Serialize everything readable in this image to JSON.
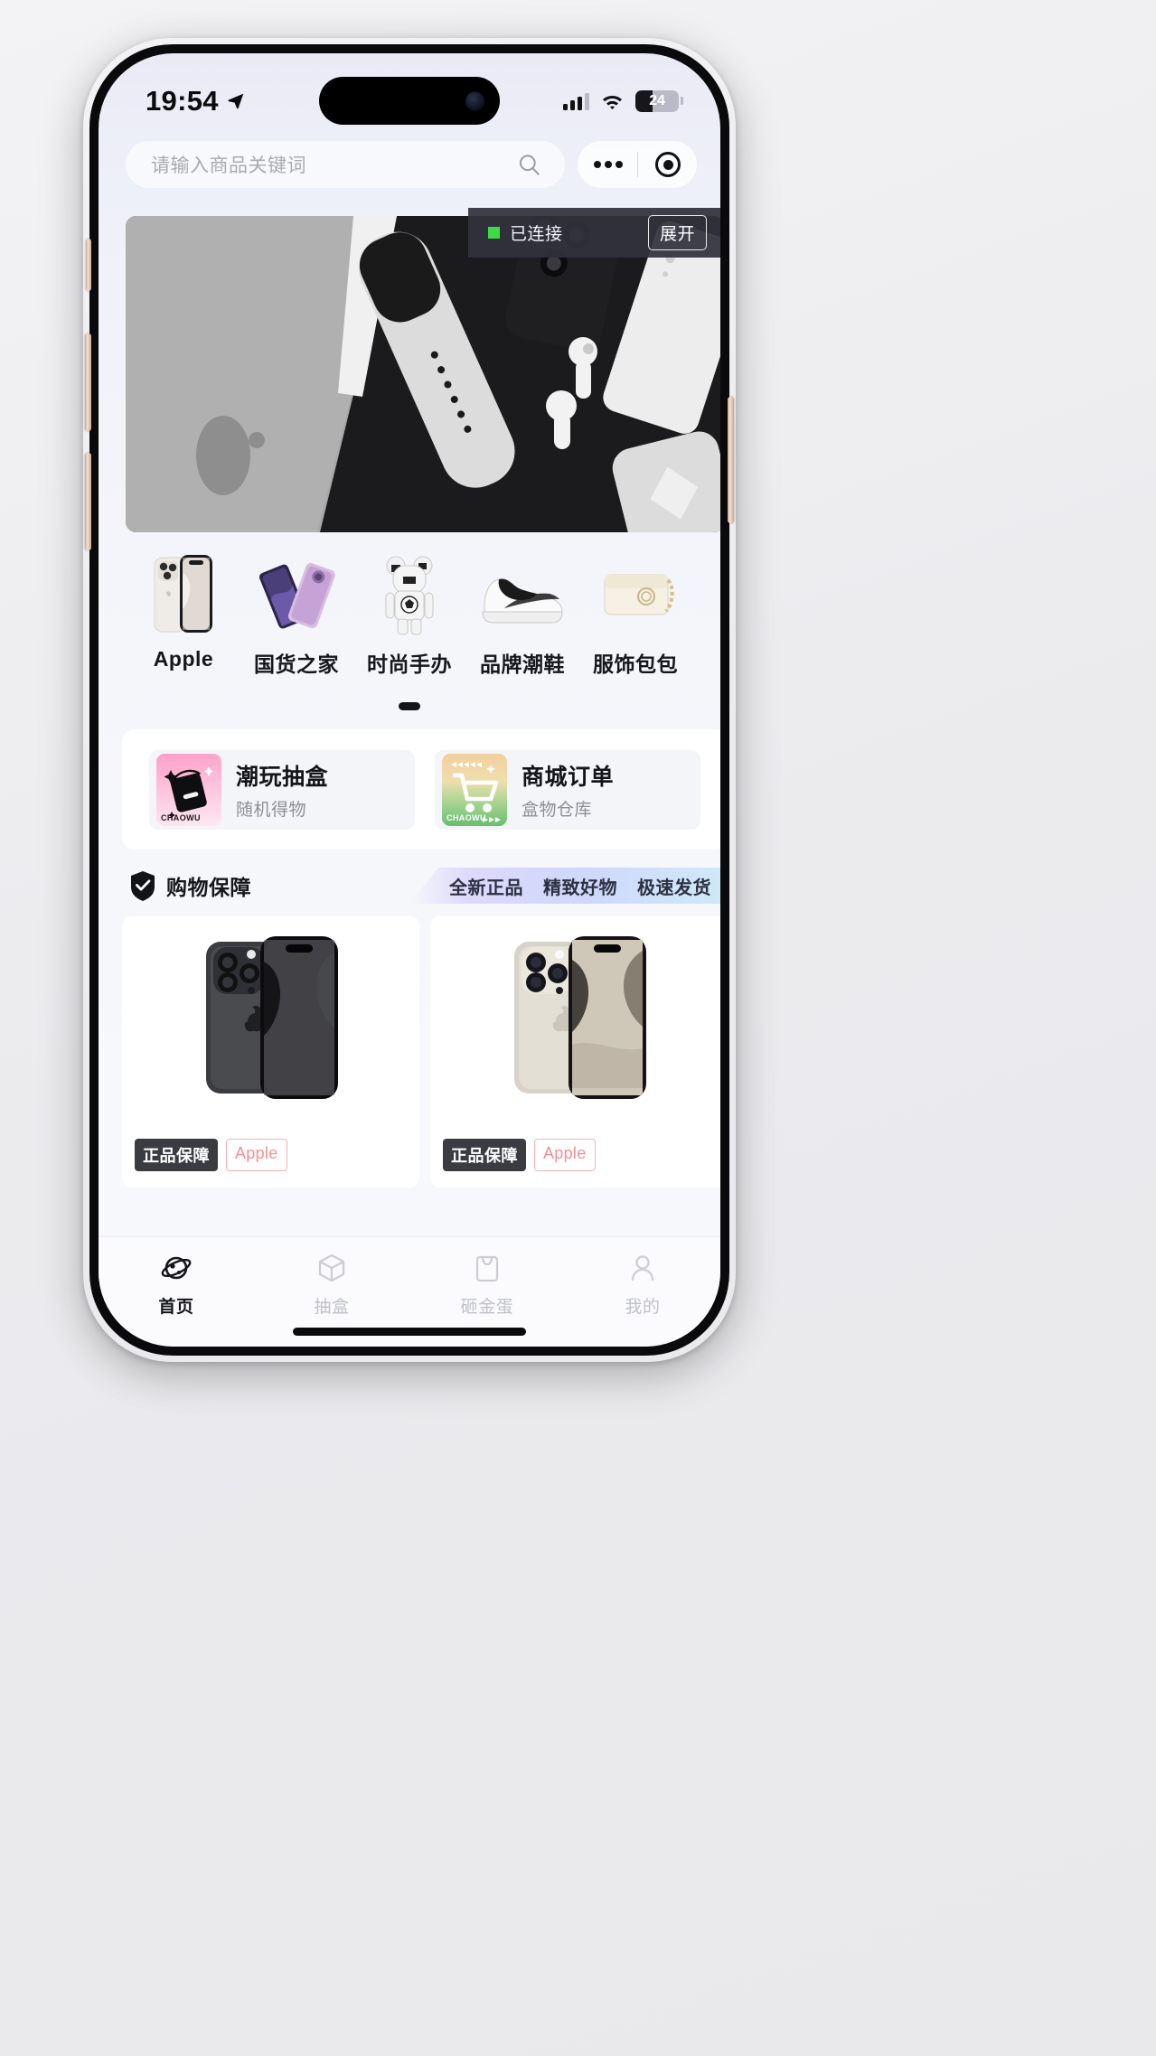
{
  "status_bar": {
    "time": "19:54",
    "location_icon": "location-arrow-icon",
    "signal_icon": "cellular-signal-icon",
    "wifi_icon": "wifi-icon",
    "battery_percent": "24"
  },
  "header": {
    "search_placeholder": "请输入商品关键词",
    "search_value": "",
    "search_icon": "search-icon",
    "capsule": {
      "more_icon": "more-dots-icon",
      "target_icon": "target-circle-icon"
    }
  },
  "dev_banner": {
    "status_dot_color": "#3ddc46",
    "status_text": "已连接",
    "expand_label": "展开"
  },
  "banner": {
    "alt": "apple-products-grayscale-banner"
  },
  "categories": [
    {
      "label": "Apple",
      "icon": "iphone-white-icon"
    },
    {
      "label": "国货之家",
      "icon": "foldable-phone-icon"
    },
    {
      "label": "时尚手办",
      "icon": "bearbrick-figure-icon"
    },
    {
      "label": "品牌潮鞋",
      "icon": "sneaker-icon"
    },
    {
      "label": "服饰包包",
      "icon": "handbag-icon"
    }
  ],
  "pager": {
    "active_index": 0
  },
  "entries": [
    {
      "title": "潮玩抽盒",
      "subtitle": "随机得物",
      "icon_brand": "CHAOWU",
      "icon": "mystery-box-icon",
      "accent": "#ff9ec7"
    },
    {
      "title": "商城订单",
      "subtitle": "盒物仓库",
      "icon_brand": "CHAOWU",
      "icon": "shopping-cart-icon",
      "accent": "#69bd71"
    }
  ],
  "guarantee": {
    "icon": "shield-check-icon",
    "label": "购物保障",
    "tags": [
      "全新正品",
      "精致好物",
      "极速发货"
    ]
  },
  "products": [
    {
      "image": "iphone-15-pro-max-black-titanium",
      "badge_primary": "正品保障",
      "badge_brand": "Apple"
    },
    {
      "image": "iphone-15-pro-max-natural-titanium",
      "badge_primary": "正品保障",
      "badge_brand": "Apple"
    }
  ],
  "tabs": [
    {
      "label": "首页",
      "icon": "planet-icon",
      "active": true
    },
    {
      "label": "抽盒",
      "icon": "box-cube-icon",
      "active": false
    },
    {
      "label": "砸金蛋",
      "icon": "gift-bag-icon",
      "active": false
    },
    {
      "label": "我的",
      "icon": "person-icon",
      "active": false
    }
  ]
}
